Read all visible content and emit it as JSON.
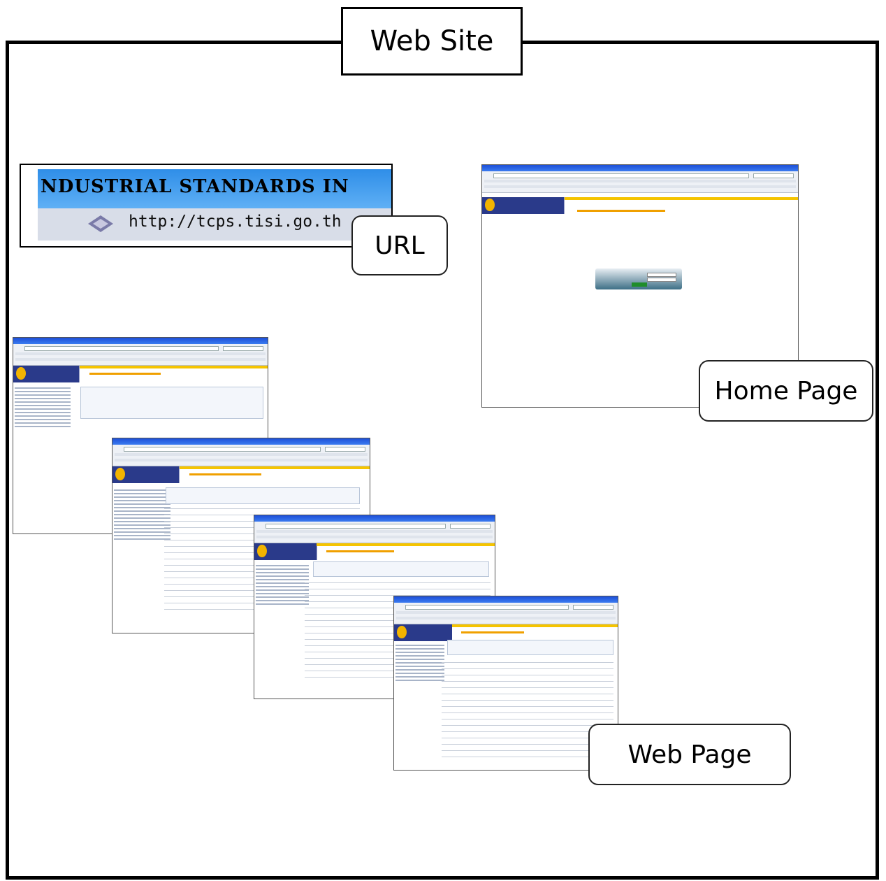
{
  "title": "Web Site",
  "callouts": {
    "url": "URL",
    "home_page": "Home Page",
    "web_page": "Web Page"
  },
  "url_snippet": {
    "banner_text": "NDUSTRIAL STANDARDS IN",
    "address": "http://tcps.tisi.go.th"
  },
  "colors": {
    "titlebar": "#1d4fd8",
    "banner_left": "#2a3a8a",
    "accent": "#f5c400",
    "url_banner": "#2f8ee8"
  }
}
